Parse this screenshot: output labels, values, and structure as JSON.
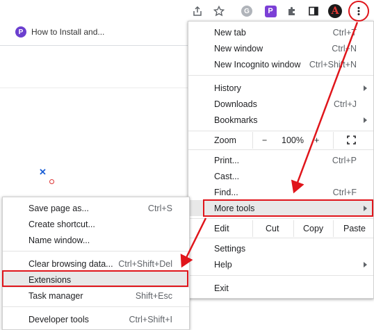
{
  "toolbar": {
    "icons": [
      "share-icon",
      "bookmark-star-icon",
      "extension-g-icon",
      "extension-p-icon",
      "extensions-puzzle-icon",
      "side-panel-icon",
      "profile-avatar-icon",
      "more-menu-icon"
    ],
    "avatar_letter": "A",
    "extension_g_letter": "G",
    "extension_p_letter": "P"
  },
  "bookmarks_bar": {
    "item_label": "How to Install and...",
    "favicon_letter": "P"
  },
  "main_menu": {
    "items": [
      {
        "label": "New tab",
        "shortcut": "Ctrl+T"
      },
      {
        "label": "New window",
        "shortcut": "Ctrl+N"
      },
      {
        "label": "New Incognito window",
        "shortcut": "Ctrl+Shift+N"
      },
      {
        "label": "History",
        "shortcut": ""
      },
      {
        "label": "Downloads",
        "shortcut": "Ctrl+J"
      },
      {
        "label": "Bookmarks",
        "shortcut": ""
      },
      {
        "label": "Print...",
        "shortcut": "Ctrl+P"
      },
      {
        "label": "Cast...",
        "shortcut": ""
      },
      {
        "label": "Find...",
        "shortcut": "Ctrl+F"
      },
      {
        "label": "More tools",
        "shortcut": ""
      },
      {
        "label": "Settings",
        "shortcut": ""
      },
      {
        "label": "Help",
        "shortcut": ""
      },
      {
        "label": "Exit",
        "shortcut": ""
      }
    ],
    "zoom": {
      "label": "Zoom",
      "minus": "−",
      "value": "100%",
      "plus": "+"
    },
    "edit": {
      "label": "Edit",
      "cut": "Cut",
      "copy": "Copy",
      "paste": "Paste"
    }
  },
  "more_tools_menu": {
    "items": [
      {
        "label": "Save page as...",
        "shortcut": "Ctrl+S"
      },
      {
        "label": "Create shortcut...",
        "shortcut": ""
      },
      {
        "label": "Name window...",
        "shortcut": ""
      },
      {
        "label": "Clear browsing data...",
        "shortcut": "Ctrl+Shift+Del"
      },
      {
        "label": "Extensions",
        "shortcut": ""
      },
      {
        "label": "Task manager",
        "shortcut": "Shift+Esc"
      },
      {
        "label": "Developer tools",
        "shortcut": "Ctrl+Shift+I"
      }
    ]
  },
  "annotation_color": "#e0151b"
}
